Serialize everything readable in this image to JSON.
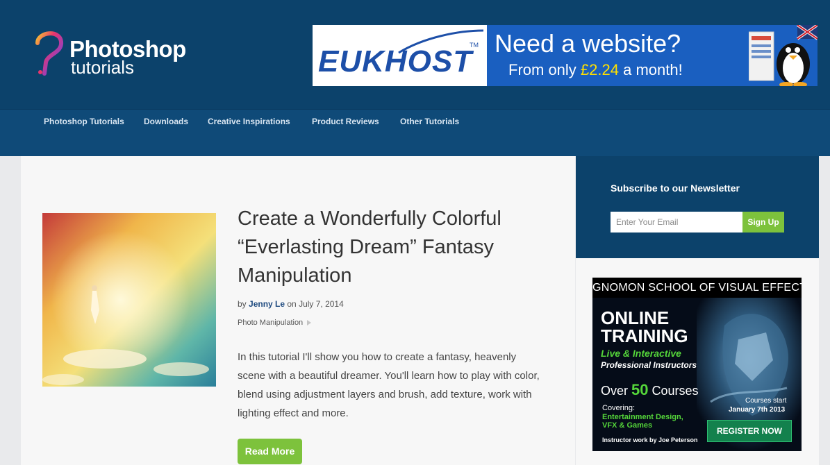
{
  "header": {
    "logo_line1": "Photoshop",
    "logo_line2": "tutorials"
  },
  "top_ad": {
    "brand": "EUKHOST",
    "tm": "TM",
    "headline": "Need a website?",
    "sub_prefix": "From only ",
    "price": "£2.24",
    "sub_suffix": " a month!"
  },
  "nav": {
    "items": [
      {
        "label": "Photoshop Tutorials"
      },
      {
        "label": "Downloads"
      },
      {
        "label": "Creative Inspirations"
      },
      {
        "label": "Product Reviews"
      },
      {
        "label": "Other Tutorials"
      }
    ]
  },
  "post": {
    "title": "Create a Wonderfully Colorful “Everlasting Dream” Fantasy Manipulation",
    "by": "by ",
    "author": "Jenny Le",
    "date_prefix": " on ",
    "date": "July 7, 2014",
    "category": "Photo Manipulation",
    "excerpt": "In this tutorial I'll show you how to create a fantasy, heavenly scene with a beautiful dreamer. You'll learn how to play with color, blend using adjustment layers and brush, add texture, work with lighting effect and more.",
    "read_more": "Read More"
  },
  "newsletter": {
    "title": "Subscribe to our Newsletter",
    "placeholder": "Enter Your Email",
    "button": "Sign Up"
  },
  "side_ad": {
    "header": "GNOMON SCHOOL OF VISUAL EFFECTS",
    "online": "ONLINE",
    "training": "TRAINING",
    "live": "Live & Interactive",
    "professional": "Professional Instructors",
    "over": "Over ",
    "count": "50",
    "courses": " Courses",
    "covering": "Covering:",
    "topic1": "Entertainment Design,",
    "topic2": "VFX & Games",
    "credit": "Instructor work by Joe Peterson",
    "starts": "Courses start",
    "start_date": "January 7th 2013",
    "register": "REGISTER NOW"
  },
  "colors": {
    "header_bg": "#0c426b",
    "nav_bg": "#0f4a78",
    "accent_green": "#7dc23c",
    "author_link": "#1f4b80"
  }
}
